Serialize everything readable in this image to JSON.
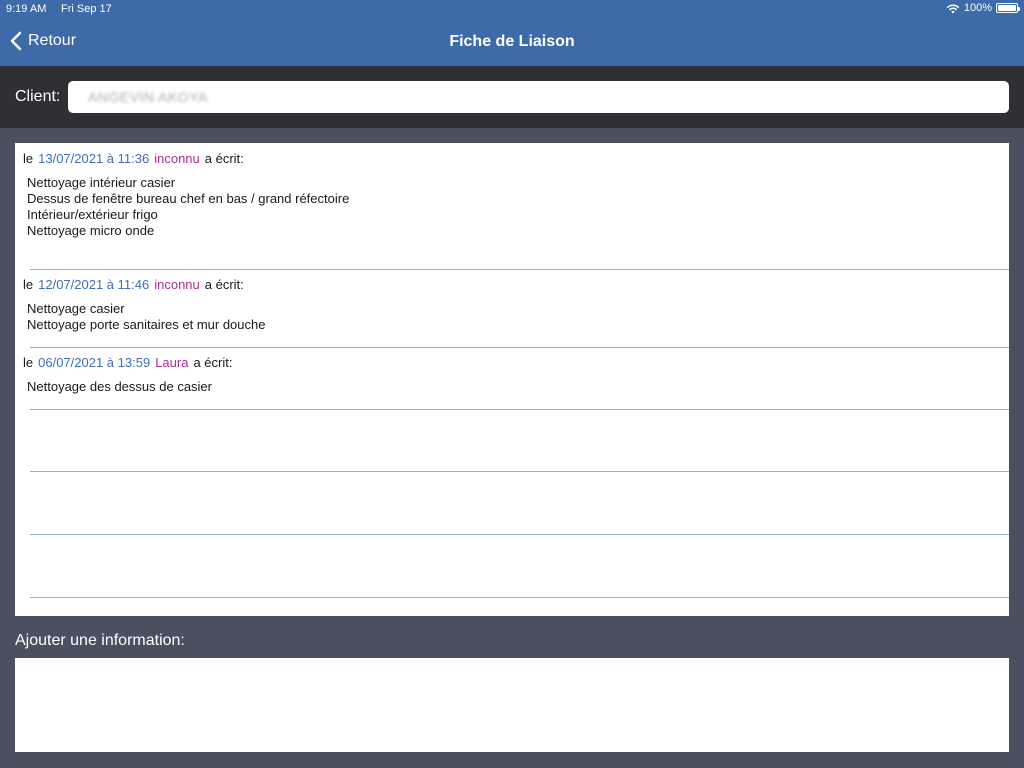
{
  "status_bar": {
    "time": "9:19 AM",
    "date": "Fri Sep 17",
    "battery": "100%",
    "battery_level": 1.0
  },
  "nav": {
    "back_label": "Retour",
    "title": "Fiche de Liaison"
  },
  "client": {
    "label": "Client:",
    "value": "ANGEVIN AKOYA"
  },
  "entries": [
    {
      "prefix": "le",
      "date": "13/07/2021 à 11:36",
      "author": "inconnu",
      "suffix": "a écrit:",
      "lines": [
        "Nettoyage intérieur casier",
        "Dessus de fenêtre bureau chef en bas / grand réfectoire",
        "Intérieur/extérieur frigo",
        "Nettoyage micro onde"
      ]
    },
    {
      "prefix": "le",
      "date": "12/07/2021 à 11:46",
      "author": "inconnu",
      "suffix": "a écrit:",
      "lines": [
        "Nettoyage casier",
        "Nettoyage porte sanitaires et mur douche"
      ]
    },
    {
      "prefix": "le",
      "date": "06/07/2021 à 13:59",
      "author": "Laura",
      "suffix": "a écrit:",
      "lines": [
        "Nettoyage des dessus de casier"
      ]
    }
  ],
  "add_info": {
    "label": "Ajouter une information:",
    "value": ""
  },
  "colors": {
    "header": "#3d6aa8",
    "date": "#3d6fb4",
    "author": "#b32b96"
  }
}
